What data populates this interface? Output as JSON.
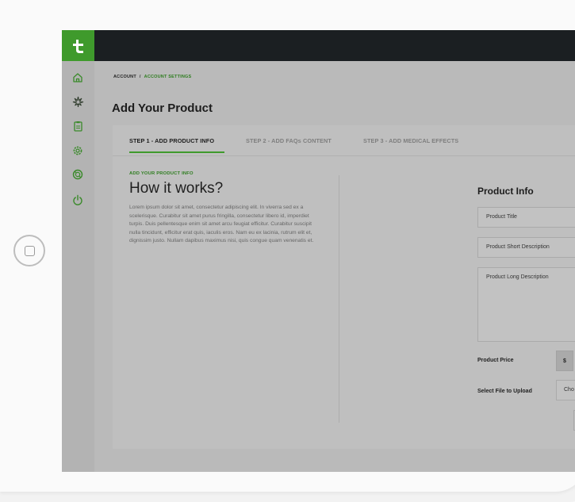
{
  "breadcrumb": {
    "root": "ACCOUNT",
    "separator": "/",
    "current": "ACCOUNT SETTINGS"
  },
  "page": {
    "title": "Add Your Product"
  },
  "tabs": [
    {
      "label": "STEP 1 - ADD PRODUCT INFO",
      "active": true
    },
    {
      "label": "STEP 2 - ADD FAQs CONTENT",
      "active": false
    },
    {
      "label": "STEP 3 - ADD MEDICAL EFFECTS",
      "active": false
    }
  ],
  "intro": {
    "kicker": "ADD YOUR PRODUCT INFO",
    "heading": "How it works?",
    "body": "Lorem ipsum dolor sit amet, consectetur adipiscing elit. In viverra sed ex a scelerisque. Curabitur sit amet purus fringilla, consectetur libero id, imperdiet turpis. Duis pellentesque enim sit amet arcu feugiat efficitur. Curabitur suscipit nulla tincidunt, efficitur erat quis, iaculis eros. Nam eu ex lacinia, rutrum elit et, dignissim justo. Nullam dapibus maximus nisi, quis congue quam venenatis et."
  },
  "form": {
    "title": "Product Info",
    "product_title_placeholder": "Product Title",
    "short_desc_placeholder": "Product Short Description",
    "long_desc_placeholder": "Product Long Description",
    "price_label": "Product Price",
    "price_prefix": "$",
    "upload_label": "Select File to Upload",
    "choose_label": "Cho"
  },
  "sidebar": {
    "items": [
      {
        "icon": "home-icon"
      },
      {
        "icon": "cannabis-leaf-icon"
      },
      {
        "icon": "clipboard-icon"
      },
      {
        "icon": "settings-icon"
      },
      {
        "icon": "support-ring-icon"
      },
      {
        "icon": "power-icon"
      }
    ]
  },
  "colors": {
    "brand_green": "#3f9a2c",
    "topbar": "#1b1f22"
  }
}
